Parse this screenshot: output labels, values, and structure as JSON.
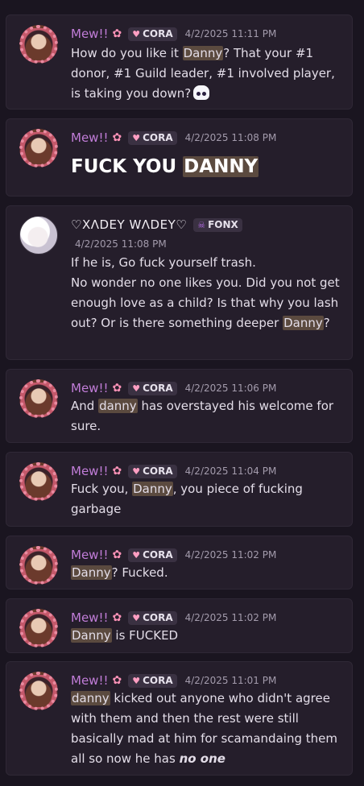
{
  "messages": [
    {
      "author": "Mew!!",
      "badge_icon": "cherry-blossom-icon",
      "tag": "CORA",
      "timestamp": "4/2/2025 11:11 PM",
      "parts": [
        "How do you like it ",
        "Danny",
        "? That your #1 donor, #1 Guild leader, #1 involved player, is taking you down?"
      ]
    },
    {
      "author": "Mew!!",
      "badge_icon": "cherry-blossom-icon",
      "tag": "CORA",
      "timestamp": "4/2/2025 11:08 PM",
      "parts": [
        "FUCK YOU ",
        "DANNY"
      ]
    },
    {
      "author": "♡XΛDEY WΛDEY♡",
      "tag": "FONX",
      "timestamp": "4/2/2025 11:08 PM",
      "parts": [
        "If he is, Go fuck yourself trash.",
        "No wonder no one likes you. Did you not get enough love as a child? Is that why you lash out? Or is there something deeper ",
        "Danny",
        "?"
      ]
    },
    {
      "author": "Mew!!",
      "badge_icon": "cherry-blossom-icon",
      "tag": "CORA",
      "timestamp": "4/2/2025 11:06 PM",
      "parts": [
        "And ",
        "danny",
        " has overstayed his welcome for sure."
      ]
    },
    {
      "author": "Mew!!",
      "badge_icon": "cherry-blossom-icon",
      "tag": "CORA",
      "timestamp": "4/2/2025 11:04 PM",
      "parts": [
        "Fuck you, ",
        "Danny",
        ", you piece of fucking garbage"
      ]
    },
    {
      "author": "Mew!!",
      "badge_icon": "cherry-blossom-icon",
      "tag": "CORA",
      "timestamp": "4/2/2025 11:02 PM",
      "parts": [
        "Danny",
        "? Fucked."
      ]
    },
    {
      "author": "Mew!!",
      "badge_icon": "cherry-blossom-icon",
      "tag": "CORA",
      "timestamp": "4/2/2025 11:02 PM",
      "parts": [
        "Danny",
        " is FUCKED"
      ]
    },
    {
      "author": "Mew!!",
      "badge_icon": "cherry-blossom-icon",
      "tag": "CORA",
      "timestamp": "4/2/2025 11:01 PM",
      "parts": [
        "danny",
        " kicked out anyone who didn't agree with them and then the rest were still basically mad at him for scamandaing them all so now he has ",
        "no one"
      ]
    }
  ],
  "colors": {
    "highlight": "#5b4a3f",
    "name_pink": "#c17dd8",
    "card_bg": "#251e2b"
  }
}
